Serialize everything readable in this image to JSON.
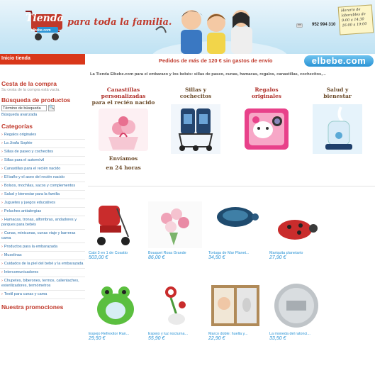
{
  "header": {
    "logo_text": "Tienda",
    "logo_sub": "elbebe.com",
    "tagline": "para toda la familia.",
    "phone": "952 994 310",
    "hours_title": "Horario de laborables de",
    "hours_1": "9:00 a 14:30",
    "hours_2": "16:00 a 19:00"
  },
  "nav": {
    "home_label": "Inicio tienda",
    "promo": "Pedidos de más de 120 € sin gastos de envío",
    "brand": "elbebe.com"
  },
  "sidebar": {
    "cart_title": "Cesta de la compra",
    "cart_empty": "Su cesta de la compra está vacía.",
    "search_title": "Búsqueda de productos",
    "search_value": "Término de búsqueda",
    "search_button": "🔍",
    "advanced_search": "Búsqueda avanzada",
    "categories_title": "Categorías",
    "categories": [
      "Regalos originales",
      "La Jirafa Sophie",
      "Sillas de paseo y cochecitos",
      "Sillas para el automóvil",
      "Canastillas para el recién nacido",
      "El baño y el aseo del recién nacido",
      "Bolsos, mochilas, sacos y complementos",
      "Salud y bienestar para la familia",
      "Juguetes y juegos educativos",
      "Peluches antialergias",
      "Hamacas, tronas, alfombras, andadores y parques para bebés",
      "Cunas, minicunas, cunas viaje y barreras cama",
      "Productos para la embarazada",
      "Muselinas",
      "Cuidados de la piel del bebé y la embarazada",
      "Intercomunicadores",
      "Chupetes, biberones, termos, calientaches, esterilizadores, termómetros",
      "Textil para cunas y cama"
    ],
    "promos_title": "Nuestra promociones"
  },
  "main": {
    "intro": "La Tienda Elbebe.com para el embarazo y los bebés:  sillas de paseo, cunas, hamacas, regalos, canastillas, cochecitos,...",
    "featured": [
      {
        "title_1": "Canastillas",
        "title_2": "personalizadas",
        "title_3": "para el recién nacido",
        "foot_1": "Envíamos",
        "foot_2": "en 24 horas"
      },
      {
        "title_1": "Sillas y",
        "title_2": "cochecitos"
      },
      {
        "title_1": "Regalos",
        "title_2": "originales"
      },
      {
        "title_1": "Salud y",
        "title_2": "bienestar"
      }
    ],
    "products": [
      {
        "name": "Cabi 3 en 1 de Cosatto",
        "price": "503,00 €"
      },
      {
        "name": "Bouquet Rosa Grande",
        "price": "86,00 €"
      },
      {
        "name": "Tortuga de Mar Planet...",
        "price": "34,50 €"
      },
      {
        "name": "Mariquita planetario",
        "price": "27,90 €"
      },
      {
        "name": "Espejo Refrexitor Ran...",
        "price": "29,50 €"
      },
      {
        "name": "Espejo y luz nocturna...",
        "price": "55,90 €"
      },
      {
        "name": "Marco doble: huella y...",
        "price": "22,90 €"
      },
      {
        "name": "La moneda del ratonci...",
        "price": "33,50 €"
      }
    ]
  }
}
